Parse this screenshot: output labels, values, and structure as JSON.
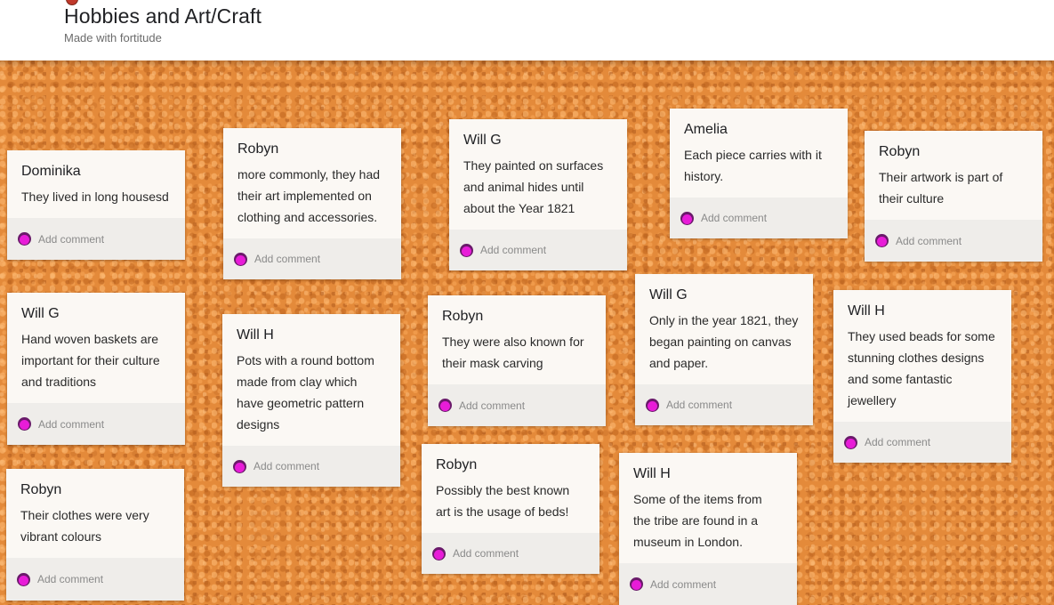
{
  "header": {
    "title": "Hobbies and Art/Craft",
    "subtitle": "Made with fortitude"
  },
  "colors": {
    "board": "#e48a3a",
    "card": "#fbf8f4",
    "comment_bar": "#efedea",
    "avatar": "#e81cd8"
  },
  "icons": {
    "comment_avatar": "avatar-icon"
  },
  "cards": [
    {
      "author": "Dominika",
      "text": "They lived in long housesd",
      "comment_label": "Add comment"
    },
    {
      "author": "Will G",
      "text": "Hand woven baskets are important for their culture and traditions",
      "comment_label": "Add comment"
    },
    {
      "author": "Robyn",
      "text": "Their clothes were very vibrant colours",
      "comment_label": "Add comment"
    },
    {
      "author": "Robyn",
      "text": "more commonly, they had their art implemented on clothing and accessories.",
      "comment_label": "Add comment"
    },
    {
      "author": "Will H",
      "text": "Pots with a round bottom made from clay which have geometric pattern designs",
      "comment_label": "Add comment"
    },
    {
      "author": "Will G",
      "text": "They painted on surfaces and animal hides until about the Year 1821",
      "comment_label": "Add comment"
    },
    {
      "author": "Robyn",
      "text": "They were also known for their mask carving",
      "comment_label": "Add comment"
    },
    {
      "author": "Robyn",
      "text": "Possibly the best known art is the usage of beds!",
      "comment_label": "Add comment"
    },
    {
      "author": "Amelia",
      "text": "Each piece carries with it history.",
      "comment_label": "Add comment"
    },
    {
      "author": "Will G",
      "text": "Only in the year 1821, they began painting on canvas and paper.",
      "comment_label": "Add comment"
    },
    {
      "author": "Will H",
      "text": "Some of the items from the tribe are found in a museum in London.",
      "comment_label": "Add comment"
    },
    {
      "author": "Robyn",
      "text": "Their artwork is part of their culture",
      "comment_label": "Add comment"
    },
    {
      "author": "Will H",
      "text": "They used beads for some stunning clothes designs and some fantastic jewellery",
      "comment_label": "Add comment"
    }
  ]
}
